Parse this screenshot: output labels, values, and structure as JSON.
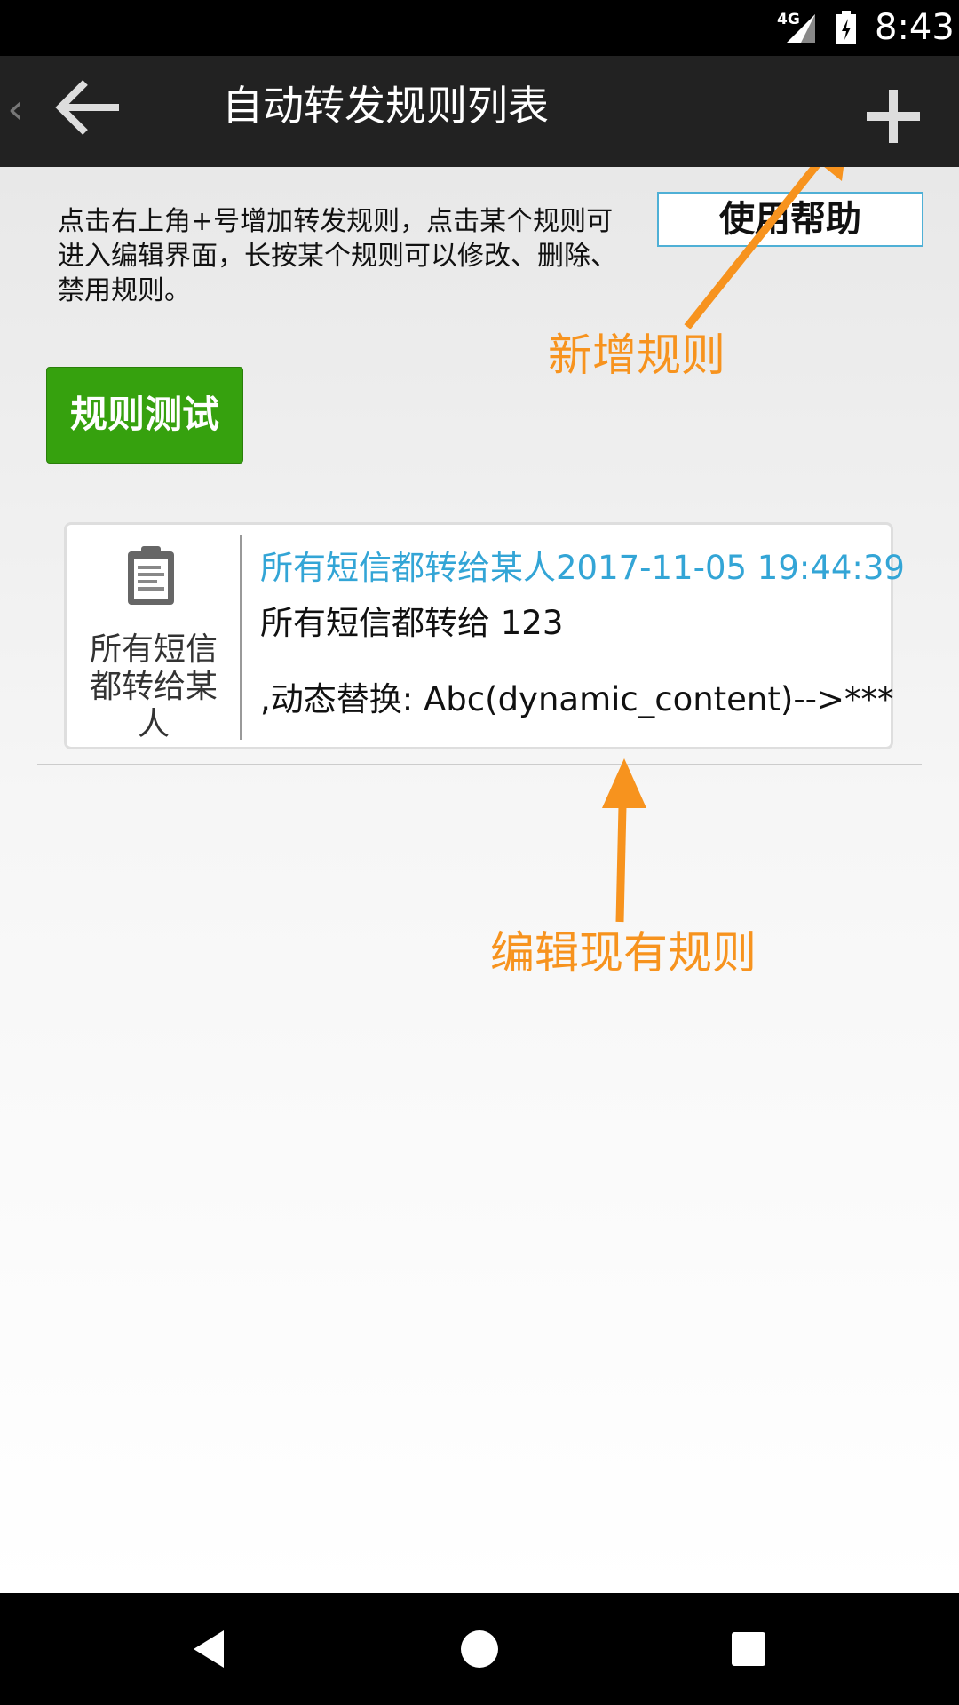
{
  "status_bar": {
    "network": "4G",
    "time": "8:43"
  },
  "toolbar": {
    "title": "自动转发规则列表",
    "back_icon": "arrow-left-icon",
    "add_icon": "plus-icon"
  },
  "help": {
    "text": "点击右上角+号增加转发规则，点击某个规则可进入编辑界面，长按某个规则可以修改、删除、禁用规则。",
    "button_label": "使用帮助"
  },
  "test_button_label": "规则测试",
  "rules": [
    {
      "icon": "clipboard-icon",
      "name": "所有短信都转给某人",
      "title": "所有短信都转给某人2017-11-05 19:44:39",
      "line1": "所有短信都转给 123",
      "line2": ",动态替换: Abc(dynamic_content)-->***"
    }
  ],
  "annotations": {
    "new_rule": "新增规则",
    "edit_rule": "编辑现有规则"
  },
  "colors": {
    "toolbar": "#222222",
    "accent_green": "#36a10e",
    "link_blue": "#33a5d6",
    "annotation_orange": "#f7931e"
  },
  "nav_bar": {
    "back": "back-triangle-icon",
    "home": "home-circle-icon",
    "recents": "recents-square-icon"
  }
}
